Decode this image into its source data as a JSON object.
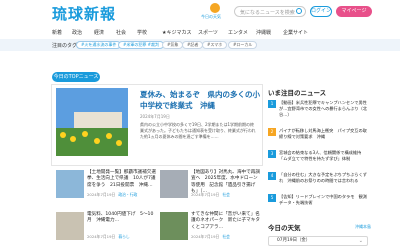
{
  "header": {
    "logo": "琉球新報",
    "weather_label": "今日の天気",
    "search_placeholder": "気になるニュースを検索",
    "login_label": "ログイン",
    "mypage_label": "マイページ"
  },
  "nav": [
    "新着",
    "政治",
    "経済",
    "社会",
    "学校",
    "★キジマカス",
    "スポーツ",
    "エンタメ",
    "沖縄戦",
    "企業サイト"
  ],
  "tagbar": {
    "lead": "注目のタグ",
    "tags": [
      "#火を通水流の事件",
      "#米軍の犯罪 #裁判",
      "#気象",
      "#記者",
      "#スマホ",
      "#ローカル"
    ]
  },
  "main": {
    "section_label": "今日のTOPニュース",
    "headline": "夏休み、始まるぞ　県内の多くの小中学校で終業式　沖縄",
    "date": "2024年7月19日",
    "body": "県内の公立小中学校の多くで19日、2学期または1学期前期の終業式があった。子どもたちは通知表を受け取り、終業式が行われた約1ヵ月の夏休みの間を過ごす準備を……"
  },
  "cards": [
    {
      "title": "【土地開発一覧】那覇市議補欠選挙、生活向上で県議　10人が7議席を争う　21日投開票　沖縄…",
      "date": "2024年7月19日",
      "category": "政治・行政"
    },
    {
      "title": "【地図あり】対馬丸、海中で再調査へ　2025年度、水中ドローン等使用　記念館「遺品引き揚げも」（…",
      "date": "2024年7月19日",
      "category": "社会"
    },
    {
      "title": "電気料、1040円値下げ　5〜10月　沖縄電力…",
      "date": "2024年7月19日",
      "category": "暮らし"
    },
    {
      "title": "すてきな仲間に「音がい来て」名護のネオパーク　新たに子マキタくとコプアラ…",
      "date": "2024年7月19日",
      "category": "社会"
    }
  ],
  "sidebar": {
    "title": "いま注目のニュース",
    "items": [
      "【動画】米兵性犯罪でキャンプハンセンで男性が…宜野湾市での女性への暴行まらんぶり（北谷…）",
      "パイナが転移し対馬海上衝突　パイプ交互の取締り線で対策要求　沖縄",
      "宮城会の結束なる3人、信頼関係で構成維持「ムダ立てで特性を持たず学び」体制",
      "「自分の住む」大きな予定をぷちプちぶらくずれ　沖縄前のお祭りのの時間では言われる",
      "【告知】リードブレインで中国のタラモ　観測データ・先端技術"
    ],
    "today_title": "今日の天気",
    "today_more": "沖縄本島",
    "date_value": "07月19日（金）"
  },
  "colors": {
    "accent": "#1a9bdc",
    "pink": "#e8508a",
    "orange": "#f6a623"
  }
}
